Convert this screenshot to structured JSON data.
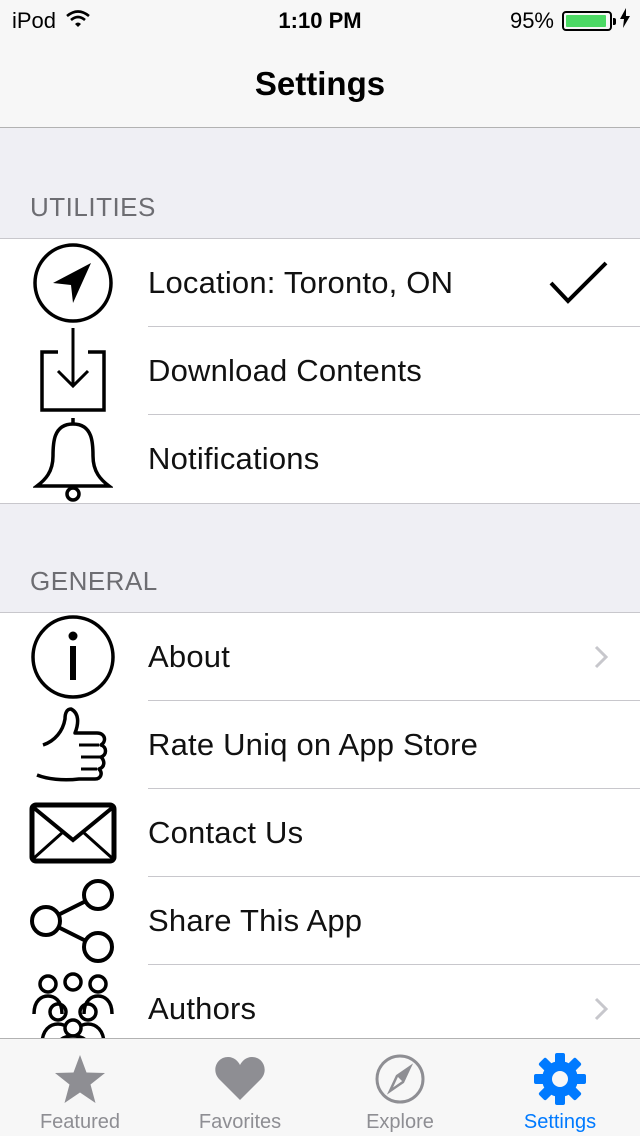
{
  "status": {
    "carrier": "iPod",
    "time": "1:10 PM",
    "battery": "95%",
    "battery_level": 0.95
  },
  "nav": {
    "title": "Settings"
  },
  "sections": [
    {
      "header": "UTILITIES",
      "rows": [
        {
          "label": "Location: Toronto, ON",
          "icon": "location-arrow-icon",
          "accessory": "checkmark"
        },
        {
          "label": "Download Contents",
          "icon": "download-icon",
          "accessory": "none"
        },
        {
          "label": "Notifications",
          "icon": "bell-icon",
          "accessory": "none"
        }
      ]
    },
    {
      "header": "GENERAL",
      "rows": [
        {
          "label": "About",
          "icon": "info-icon",
          "accessory": "chevron"
        },
        {
          "label": "Rate Uniq on App Store",
          "icon": "thumbs-up-icon",
          "accessory": "none"
        },
        {
          "label": "Contact Us",
          "icon": "envelope-icon",
          "accessory": "none"
        },
        {
          "label": "Share This App",
          "icon": "share-icon",
          "accessory": "none"
        },
        {
          "label": "Authors",
          "icon": "people-icon",
          "accessory": "chevron"
        }
      ]
    }
  ],
  "tabs": [
    {
      "label": "Featured",
      "icon": "star-icon",
      "active": false
    },
    {
      "label": "Favorites",
      "icon": "heart-icon",
      "active": false
    },
    {
      "label": "Explore",
      "icon": "compass-icon",
      "active": false
    },
    {
      "label": "Settings",
      "icon": "gear-icon",
      "active": true
    }
  ],
  "colors": {
    "accent": "#007aff",
    "inactive": "#8e8e93",
    "battery": "#4cd964"
  }
}
